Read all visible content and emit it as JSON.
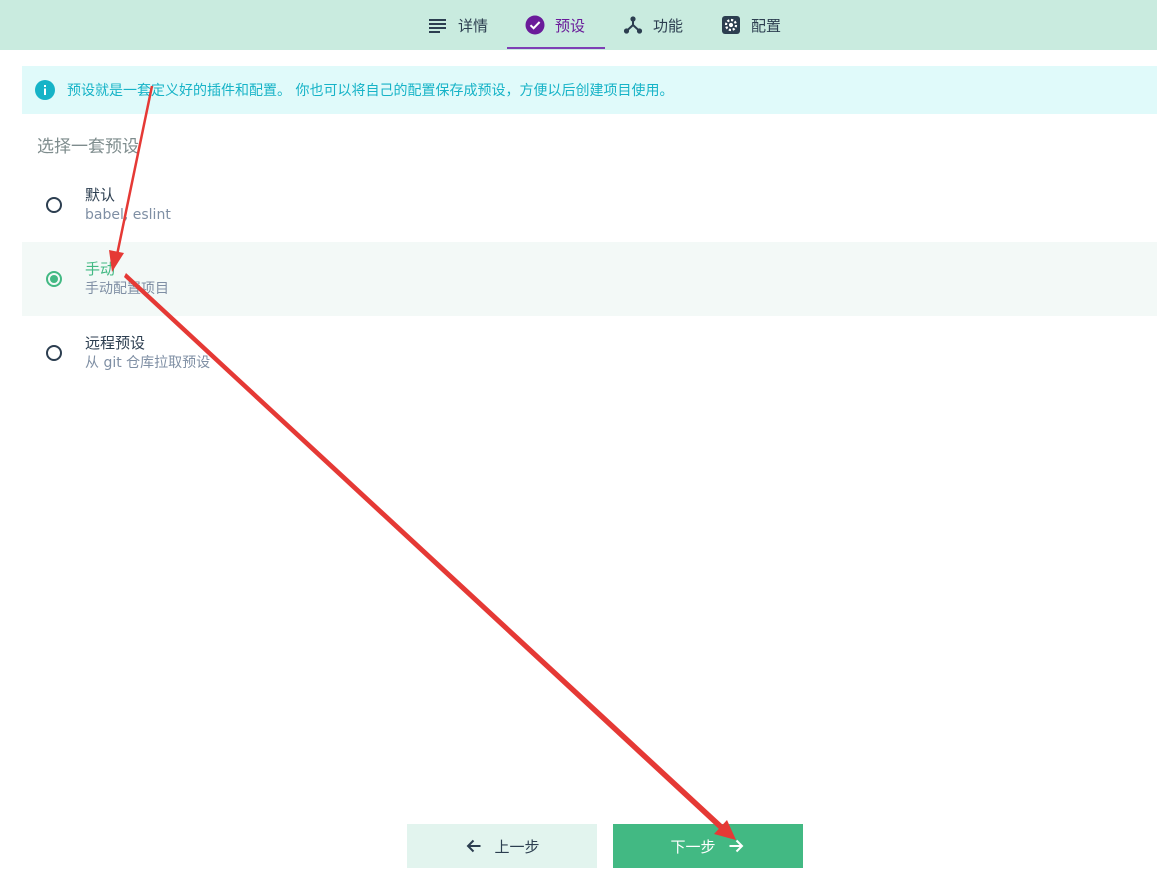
{
  "tabs": [
    {
      "label": "详情",
      "icon": "details-icon"
    },
    {
      "label": "预设",
      "icon": "check-circle-icon"
    },
    {
      "label": "功能",
      "icon": "features-icon"
    },
    {
      "label": "配置",
      "icon": "gear-icon"
    }
  ],
  "active_tab": "预设",
  "info_banner": {
    "text": "预设就是一套定义好的插件和配置。 你也可以将自己的配置保存成预设，方便以后创建项目使用。",
    "icon": "info-icon"
  },
  "section_title": "选择一套预设",
  "presets": [
    {
      "name": "默认",
      "description": "babel, eslint",
      "selected": false
    },
    {
      "name": "手动",
      "description": "手动配置项目",
      "selected": true
    },
    {
      "name": "远程预设",
      "description": "从 git 仓库拉取预设",
      "selected": false
    }
  ],
  "buttons": {
    "prev": "上一步",
    "next": "下一步"
  },
  "colors": {
    "topbar_bg": "#c9ebdf",
    "accent_green": "#42b983",
    "accent_purple": "#6a1b9a",
    "info_text": "#16b3c7",
    "info_bg": "#e0fafa",
    "annotation_red": "#e53935"
  }
}
